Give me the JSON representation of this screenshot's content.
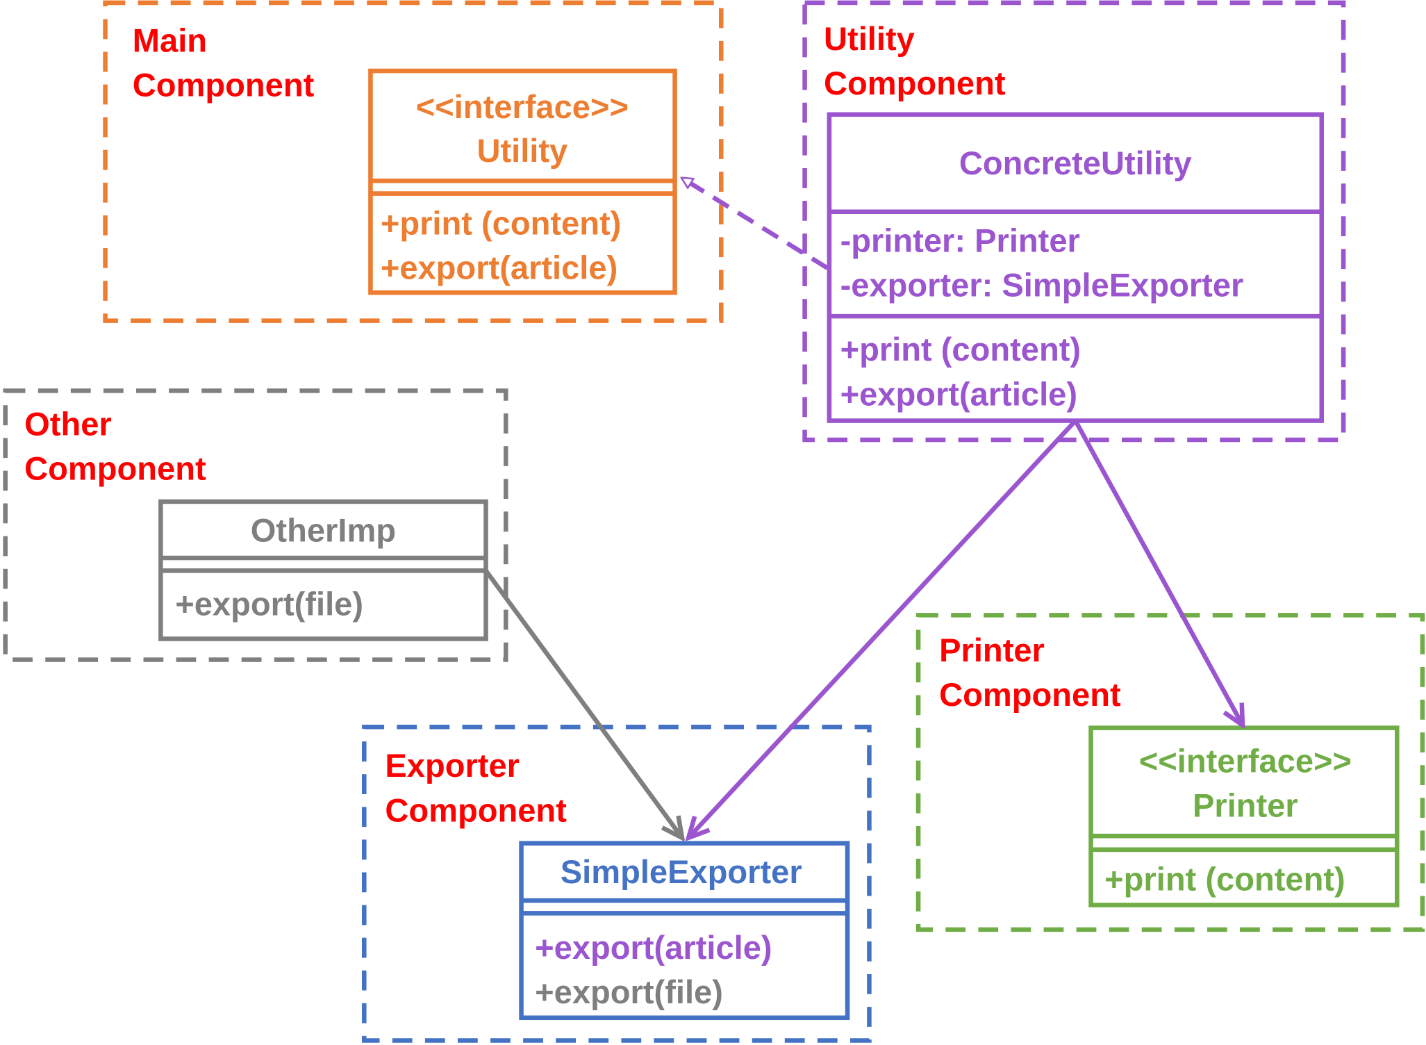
{
  "colors": {
    "label": "#FF0000",
    "main": "#ED7D31",
    "utility": "#9A55CF",
    "other": "#7F7F7F",
    "exporter": "#4472C4",
    "printer": "#70AD47"
  },
  "components": {
    "main": {
      "label_line1": "Main",
      "label_line2": "Component"
    },
    "utility": {
      "label_line1": "Utility",
      "label_line2": "Component"
    },
    "other": {
      "label_line1": "Other",
      "label_line2": "Component"
    },
    "exporter": {
      "label_line1": "Exporter",
      "label_line2": "Component"
    },
    "printer": {
      "label_line1": "Printer",
      "label_line2": "Component"
    }
  },
  "classes": {
    "utility_interface": {
      "stereotype": "<<interface>>",
      "name": "Utility",
      "methods": [
        "+print (content)",
        "+export(article)"
      ]
    },
    "concrete_utility": {
      "name": "ConcreteUtility",
      "attributes": [
        "-printer: Printer",
        "-exporter: SimpleExporter"
      ],
      "methods": [
        "+print (content)",
        "+export(article)"
      ]
    },
    "other_imp": {
      "name": "OtherImp",
      "methods": [
        "+export(file)"
      ]
    },
    "simple_exporter": {
      "name": "SimpleExporter",
      "methods": [
        "+export(article)",
        "+export(file)"
      ]
    },
    "printer_interface": {
      "stereotype": "<<interface>>",
      "name": "Printer",
      "methods": [
        "+print (content)"
      ]
    }
  },
  "relations": [
    {
      "from": "ConcreteUtility",
      "to": "Utility",
      "type": "realization"
    },
    {
      "from": "ConcreteUtility",
      "to": "SimpleExporter",
      "type": "association"
    },
    {
      "from": "ConcreteUtility",
      "to": "Printer",
      "type": "association"
    },
    {
      "from": "OtherImp",
      "to": "SimpleExporter",
      "type": "association"
    }
  ]
}
